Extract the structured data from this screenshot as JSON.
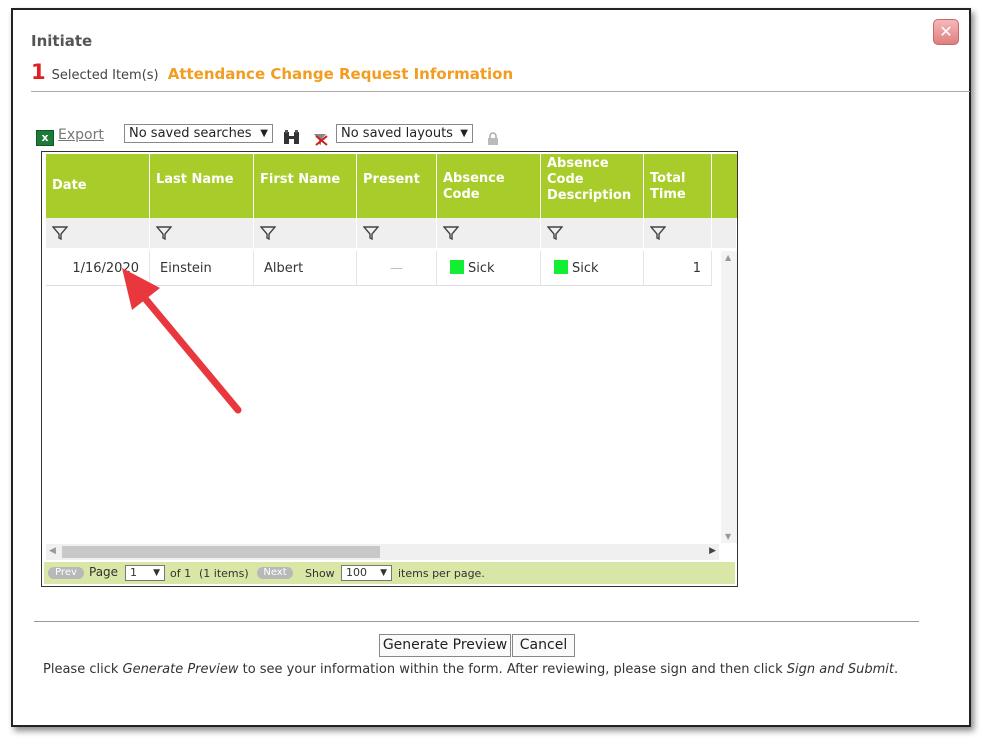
{
  "dialog": {
    "title": "Initiate",
    "selected_count": "1",
    "selected_label": "Selected Item(s)",
    "section_title": "Attendance Change Request Information",
    "close_icon": "close-icon"
  },
  "toolbar": {
    "export_label": "Export",
    "saved_searches": "No saved searches",
    "saved_layouts": "No saved layouts"
  },
  "grid": {
    "columns": [
      "Date",
      "Last Name",
      "First Name",
      "Present",
      "Absence Code",
      "Absence Code Description",
      "Total Time"
    ],
    "rows": [
      {
        "date": "1/16/2020",
        "last_name": "Einstein",
        "first_name": "Albert",
        "present": "—",
        "absence_code": "Sick",
        "absence_code_description": "Sick",
        "total_time": "1"
      }
    ],
    "status_color": "#11ee33",
    "header_color": "#a8cc2a"
  },
  "pager": {
    "prev": "Prev",
    "page_label": "Page",
    "page_value": "1",
    "of_text": "of 1",
    "items_text": "(1 items)",
    "next": "Next",
    "show_label": "Show",
    "per_page_value": "100",
    "per_page_suffix": "items per page."
  },
  "actions": {
    "generate_preview": "Generate Preview",
    "cancel": "Cancel"
  },
  "instructions": {
    "part1": "Please click ",
    "generate_em": "Generate Preview",
    "part2": " to see your information within the form. After reviewing, please sign and then click ",
    "sign_em": "Sign and Submit",
    "part3": "."
  }
}
